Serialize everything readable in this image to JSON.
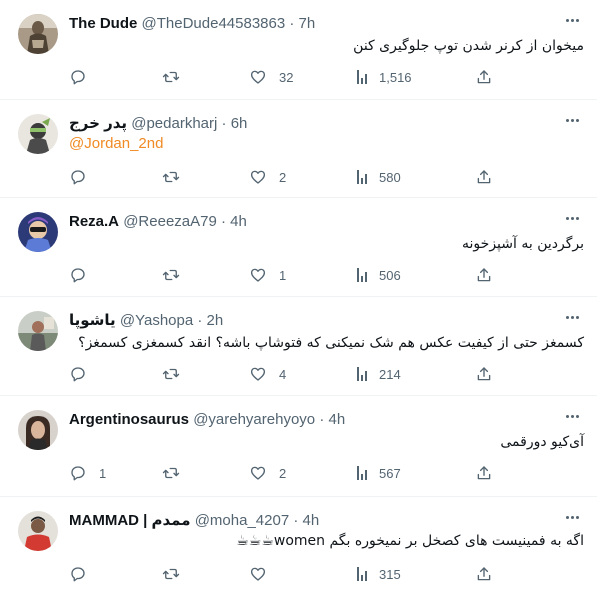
{
  "tweets": [
    {
      "name": "The Dude",
      "handle": "@TheDude44583863",
      "time": "7h",
      "text": "میخوان از کرنر شدن توپ جلوگیری کنن",
      "replies": "",
      "retweets": "",
      "likes": "32",
      "views": "1,516",
      "avatar_color": "#7b6a55"
    },
    {
      "name": "پدر خرج",
      "handle": "@pedarkharj",
      "time": "6h",
      "text": "@Jordan_2nd",
      "replies": "",
      "retweets": "",
      "likes": "2",
      "views": "580",
      "avatar_color": "#6b8c5e"
    },
    {
      "name": "Reza.A",
      "handle": "@ReeezaA79",
      "time": "4h",
      "text": "برگردین به آشپزخونه",
      "replies": "",
      "retweets": "",
      "likes": "1",
      "views": "506",
      "avatar_color": "#3a4a8c"
    },
    {
      "name": "یاشوپا",
      "handle": "@Yashopa",
      "time": "2h",
      "text": "کسمغز حتی از کیفیت عکس هم شک نمیکنی که فتوشاپ باشه؟ انقد کسمغزی کسمغز؟",
      "replies": "",
      "retweets": "",
      "likes": "4",
      "views": "214",
      "avatar_color": "#9aa39a"
    },
    {
      "name": "Argentinosaurus",
      "handle": "@yarehyarehyoyo",
      "time": "4h",
      "text": "آی‌کیو دورقمی",
      "replies": "1",
      "retweets": "",
      "likes": "2",
      "views": "567",
      "avatar_color": "#5a4640"
    },
    {
      "name": "MAMMAD | ممدم",
      "handle": "@moha_4207",
      "time": "4h",
      "text": "اگه به فمینیست های کصخل بر نمیخوره بگم women☕☕☕",
      "replies": "",
      "retweets": "",
      "likes": "",
      "views": "315",
      "avatar_color": "#c8322e"
    }
  ],
  "separator": "·"
}
